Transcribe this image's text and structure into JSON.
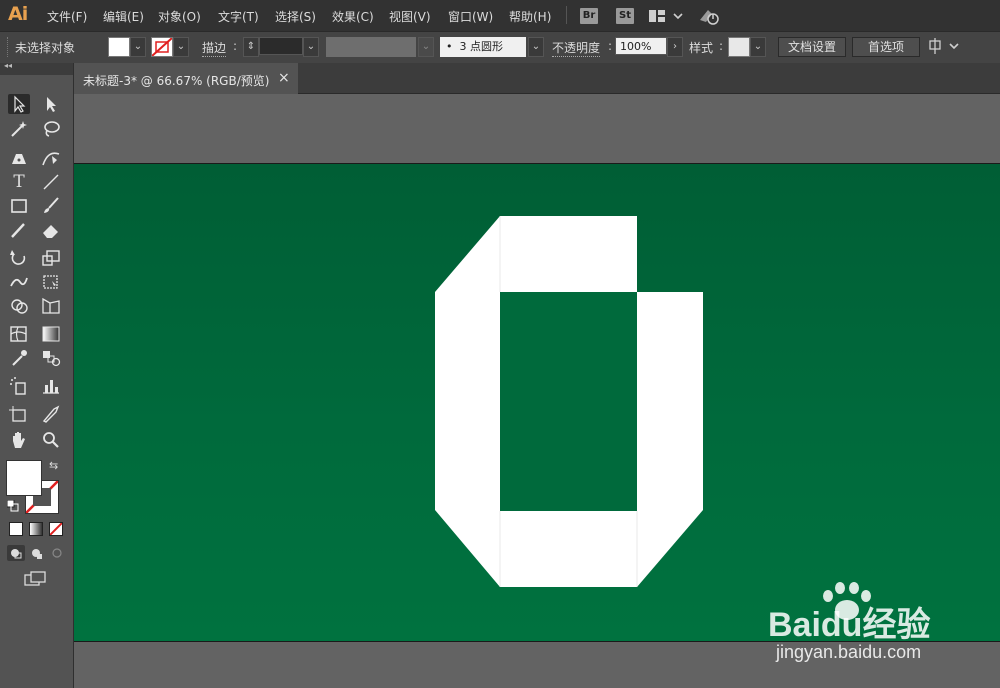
{
  "app": {
    "logo": "Ai",
    "menu": [
      "文件(F)",
      "编辑(E)",
      "对象(O)",
      "文字(T)",
      "选择(S)",
      "效果(C)",
      "视图(V)",
      "窗口(W)",
      "帮助(H)"
    ],
    "bridge_label": "Br",
    "stock_label": "St"
  },
  "control": {
    "selection_status": "未选择对象",
    "stroke_label": "描边",
    "brush_value": "3 点圆形",
    "brush_prefix": "•",
    "opacity_label": "不透明度",
    "opacity_value": "100%",
    "style_label": "样式",
    "doc_setup_button": "文档设置",
    "preferences_button": "首选项"
  },
  "document": {
    "tab_title": "未标题-3* @ 66.67% (RGB/预览)",
    "close_glyph": "×",
    "artboard_color": "#006a3c",
    "shape_color": "#ffffff"
  },
  "toolbox": {
    "collapse_glyph": "◂◂",
    "swap_glyph": "⇆"
  },
  "watermark": {
    "brand": "Baidu经验",
    "url": "jingyan.baidu.com"
  }
}
